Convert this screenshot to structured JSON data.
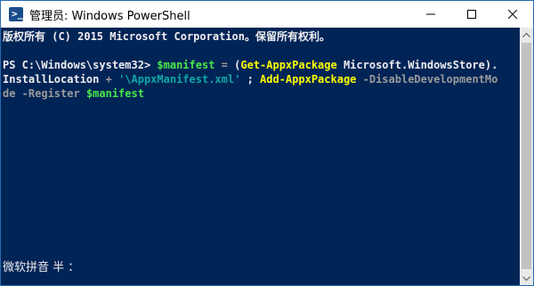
{
  "window": {
    "title": "管理员: Windows PowerShell",
    "icon": "powershell-icon",
    "controls": [
      "minimize-icon",
      "maximize-icon",
      "close-icon"
    ]
  },
  "console": {
    "copyright": "版权所有 (C) 2015 Microsoft Corporation。保留所有权利。",
    "prompt": "PS C:\\Windows\\system32> ",
    "cmd_var1": "$manifest",
    "cmd_eq": " = ",
    "cmd_paren_open": "(",
    "cmd_getappx": "Get-AppxPackage",
    "cmd_pkgname": " Microsoft.WindowsStore",
    "cmd_paren_close": ").",
    "line2_prop": "InstallLocation",
    "line2_plus": " + ",
    "line2_string": "'\\AppxManifest.xml'",
    "line2_sep": " ; ",
    "line2_addappx": "Add-AppxPackage",
    "line2_param": " -DisableDevelopmentMo",
    "line3_param_cont": "de",
    "line3_register": " -Register ",
    "line3_var": "$manifest"
  },
  "ime": {
    "status": "微软拼音 半 ："
  },
  "colors": {
    "console_bg": "#012456",
    "console_text": "#eeedf0",
    "variable": "#48e848",
    "command": "#ffff00",
    "parameter": "#9a9a9a",
    "string": "#0fa8a8"
  }
}
